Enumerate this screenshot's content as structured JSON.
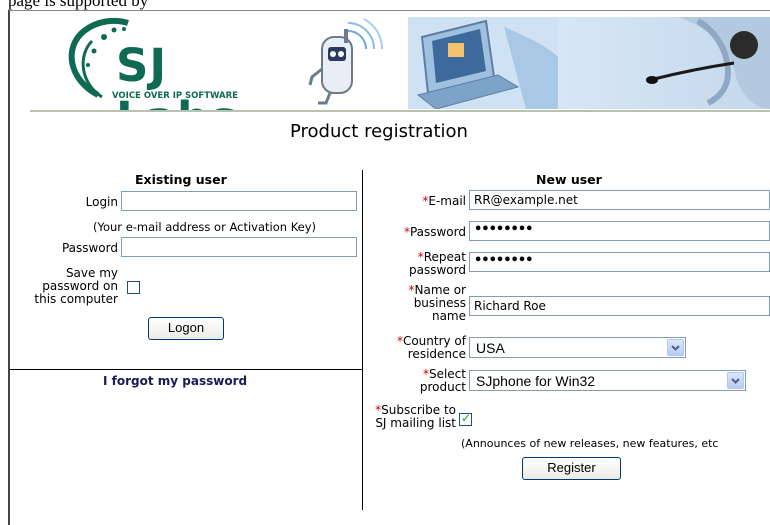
{
  "page": {
    "top_caption": "page is supported by",
    "title": "Product registration"
  },
  "brand": {
    "logo_text": "SJ Labs",
    "tagline": "VOICE OVER IP SOFTWARE",
    "color": "#0e6a52"
  },
  "existing_user": {
    "heading": "Existing user",
    "login_label": "Login",
    "login_value": "",
    "login_hint": "(Your e-mail address or Activation Key)",
    "password_label": "Password",
    "password_value": "",
    "save_label_1": "Save my",
    "save_label_2": "password on",
    "save_label_3": "this computer",
    "save_checked": false,
    "logon_button": "Logon",
    "forgot_link": "I forgot my password"
  },
  "new_user": {
    "heading": "New user",
    "required_mark": "*",
    "email_label": "E-mail",
    "email_value": "RR@example.net",
    "password_label": "Password",
    "password_mask": "••••••••",
    "repeat_label_1": "Repeat",
    "repeat_label_2": "password",
    "repeat_mask": "••••••••",
    "name_label_1": "Name or",
    "name_label_2": "business",
    "name_label_3": "name",
    "name_value": "Richard Roe",
    "country_label_1": "Country of",
    "country_label_2": "residence",
    "country_value": "USA",
    "product_label_1": "Select",
    "product_label_2": "product",
    "product_value": "SJphone for Win32",
    "subscribe_label_1": "Subscribe to",
    "subscribe_label_2": "SJ mailing list",
    "subscribe_checked": true,
    "subscribe_note": "(Announces of new releases, new features, etc",
    "register_button": "Register"
  },
  "icons": [
    "phone-mascot-icon",
    "computer-monitor-icon",
    "headset-woman-banner"
  ],
  "colors": {
    "required": "#cc0000",
    "field_border": "#7f9db9",
    "link": "#1a1a5a"
  }
}
